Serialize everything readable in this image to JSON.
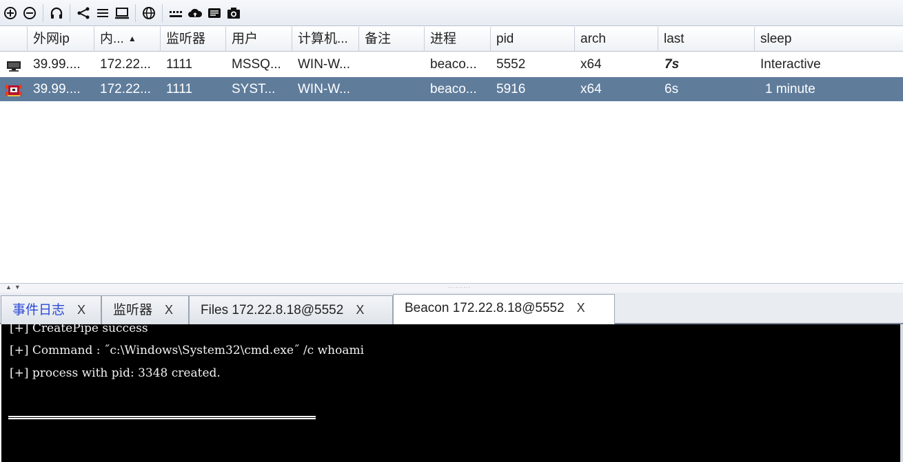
{
  "toolbar": {
    "icons": [
      "zoom-in-icon",
      "zoom-out-icon",
      "headphones-icon",
      "share-graph-icon",
      "list-icon",
      "screen-icon",
      "globe-icon",
      "keyboard-icon",
      "cloud-icon",
      "message-icon",
      "camera-icon"
    ]
  },
  "table": {
    "columns": [
      "外网ip",
      "内...",
      "监听器",
      "用户",
      "计算机...",
      "备注",
      "进程",
      "pid",
      "arch",
      "last",
      "sleep"
    ],
    "sort_indicator": "▲",
    "rows": [
      {
        "external_ip": "39.99....",
        "internal_ip": "172.22...",
        "listener": "1111",
        "user": "MSSQ...",
        "computer": "WIN-W...",
        "note": "",
        "process": "beaco...",
        "pid": "5552",
        "arch": "x64",
        "last": "7s",
        "sleep": "Interactive",
        "selected": false
      },
      {
        "external_ip": "39.99....",
        "internal_ip": "172.22...",
        "listener": "1111",
        "user": "SYST...",
        "computer": "WIN-W...",
        "note": "",
        "process": "beaco...",
        "pid": "5916",
        "arch": "x64",
        "last": "6s",
        "sleep": "1 minute",
        "selected": true
      }
    ]
  },
  "tabs": [
    {
      "label": "事件日志",
      "close": "X"
    },
    {
      "label": "监听器",
      "close": "X"
    },
    {
      "label": "Files 172.22.8.18@5552",
      "close": "X"
    },
    {
      "label": "Beacon 172.22.8.18@5552",
      "close": "X"
    }
  ],
  "console": {
    "lines": [
      "[+] CreatePipe success",
      "[+] Command : ˝c:\\Windows\\System32\\cmd.exe˝ /c whoami",
      "[+] process with pid: 3348 created."
    ]
  },
  "colors": {
    "selected_row": "#5f7c9b",
    "console_bg": "#000000",
    "event_tab_text": "#2a48d8"
  }
}
